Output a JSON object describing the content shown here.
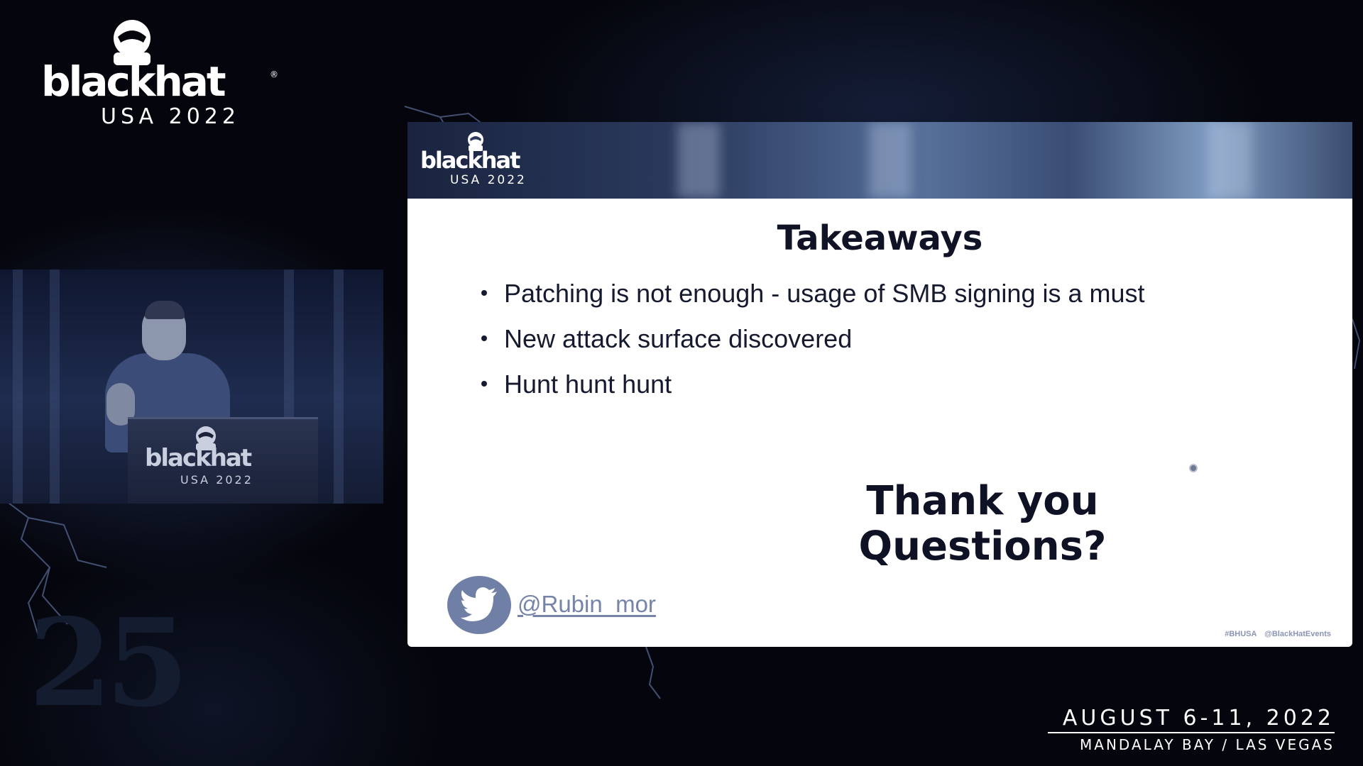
{
  "event": {
    "brand": "blackhat",
    "edition": "USA 2022",
    "date": "AUGUST 6-11, 2022",
    "venue": "MANDALAY BAY / LAS VEGAS"
  },
  "podium": {
    "brand": "blackhat",
    "edition": "USA 2022"
  },
  "slide": {
    "logo_brand": "blackhat",
    "logo_edition": "USA 2022",
    "title": "Takeaways",
    "bullets": [
      "Patching is not enough - usage of SMB signing is a must",
      "New attack surface discovered",
      "Hunt hunt hunt"
    ],
    "closing_line_1": "Thank you",
    "closing_line_2": "Questions?",
    "twitter_handle": "@Rubin_mor",
    "footer_hashtag": "#BHUSA",
    "footer_account": "@BlackHatEvents"
  },
  "background": {
    "anniversary_mark": "25"
  },
  "colors": {
    "background": "#05060d",
    "slide_background": "#ffffff",
    "slide_text": "#151a2e",
    "twitter_accent": "#6f7fa6"
  },
  "icons": [
    "hat-logo-icon",
    "twitter-bird-icon"
  ]
}
